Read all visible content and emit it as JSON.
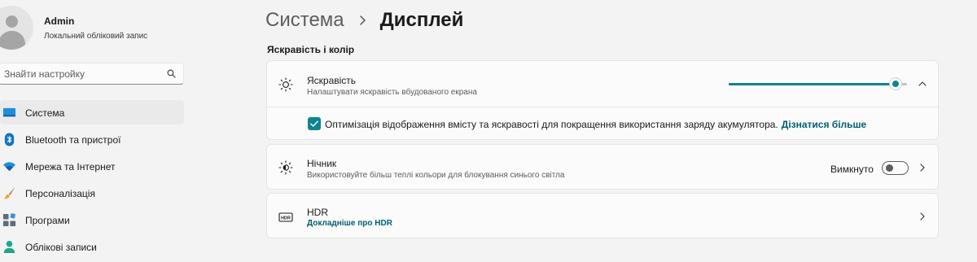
{
  "profile": {
    "name": "Admin",
    "subtitle": "Локальний обліковий запис"
  },
  "search": {
    "placeholder": "Знайти настройку"
  },
  "sidebar": {
    "items": [
      {
        "label": "Система",
        "icon": "system-icon",
        "active": true
      },
      {
        "label": "Bluetooth та пристрої",
        "icon": "bluetooth-icon"
      },
      {
        "label": "Мережа та Інтернет",
        "icon": "wifi-icon"
      },
      {
        "label": "Персоналізація",
        "icon": "brush-icon"
      },
      {
        "label": "Програми",
        "icon": "apps-icon"
      },
      {
        "label": "Облікові записи",
        "icon": "person-icon"
      }
    ]
  },
  "header": {
    "parent": "Система",
    "current": "Дисплей"
  },
  "section": {
    "title": "Яскравість і колір"
  },
  "brightness": {
    "title": "Яскравість",
    "subtitle": "Налаштувати яскравість вбудованого екрана",
    "value": 100,
    "expanded": true,
    "optimize_label": "Оптимізація відображення вмісту та яскравості для покращення використання заряду акумулятора.",
    "optimize_link": "Дізнатися більше",
    "optimize_checked": true
  },
  "night_light": {
    "title": "Нічник",
    "subtitle": "Використовуйте більш теплі кольори для блокування синього світла",
    "state_label": "Вимкнуто",
    "on": false
  },
  "hdr": {
    "title": "HDR",
    "link": "Докладніше про HDR"
  },
  "colors": {
    "accent": "#0f8390",
    "link": "#005e73",
    "background": "#f3f3f3",
    "card": "#fbfbfb"
  }
}
